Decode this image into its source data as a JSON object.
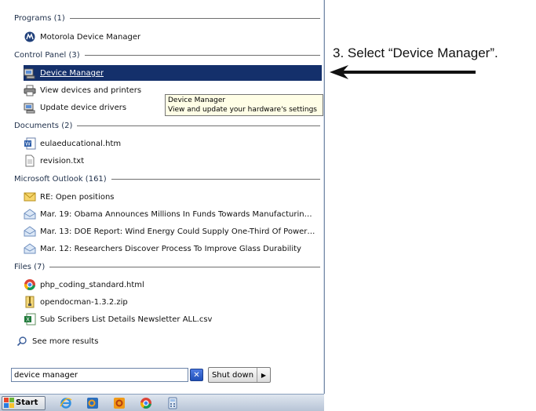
{
  "groups": {
    "programs": "Programs (1)",
    "control_panel": "Control Panel (3)",
    "documents": "Documents (2)",
    "outlook": "Microsoft Outlook (161)",
    "files": "Files (7)"
  },
  "items": {
    "motorola": "Motorola Device Manager",
    "device_manager": "Device Manager",
    "devices_printers": "View devices and printers",
    "update_drivers": "Update device drivers",
    "eula": "eulaeducational.htm",
    "revision": "revision.txt",
    "mail1": "RE: Open positions",
    "mail2": "Mar. 19: Obama Announces Millions In Funds Towards Manufacturing-F...",
    "mail3": "Mar. 13: DOE Report: Wind Energy Could Supply One-Third Of Power I...",
    "mail4": "Mar. 12: Researchers Discover Process To Improve Glass Durability",
    "file1": "php_coding_standard.html",
    "file2": "opendocman-1.3.2.zip",
    "file3": "Sub Scribers List Details Newsletter ALL.csv",
    "see_more": "See more results"
  },
  "tooltip": {
    "title": "Device Manager",
    "desc": "View and update your hardware's settings"
  },
  "search": {
    "value": "device manager"
  },
  "shutdown": {
    "label": "Shut down"
  },
  "taskbar": {
    "start": "Start"
  },
  "annotation": "3. Select “Device Manager”.",
  "colors": {
    "selection": "#14306b",
    "tooltip_bg": "#fffee6"
  },
  "icons": [
    "motorola-icon",
    "device-manager-icon",
    "printer-icon",
    "driver-icon",
    "word-doc-icon",
    "text-file-icon",
    "mail-icon",
    "rss-icon",
    "chrome-icon",
    "zip-icon",
    "excel-icon",
    "search-icon",
    "clear-icon",
    "windows-logo-icon",
    "ie-icon",
    "outlook-icon",
    "powerpoint-icon",
    "calculator-icon"
  ]
}
